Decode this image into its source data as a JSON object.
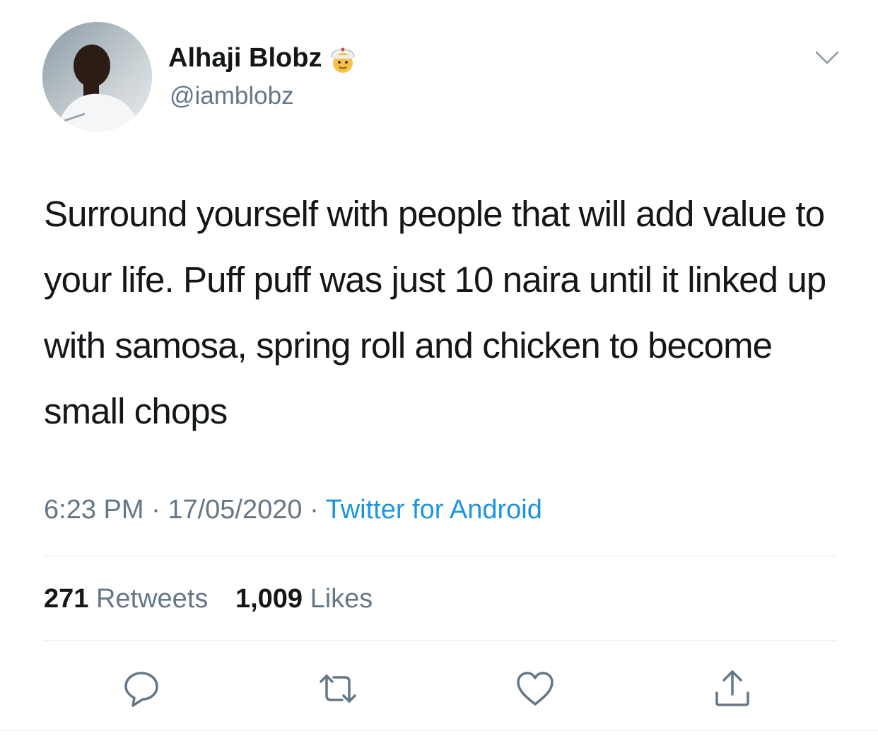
{
  "tweet": {
    "author": {
      "display_name": "Alhaji Blobz",
      "badge_emoji": "man-with-turban-emoji",
      "handle": "@iamblobz"
    },
    "menu_icon": "chevron-down-icon",
    "text": "Surround yourself with people that will add value to your life. Puff puff was just 10 naira until it linked up with samosa, spring roll and chicken to become small chops",
    "time": "6:23 PM",
    "separator": "·",
    "date": "17/05/2020",
    "source": "Twitter for Android",
    "stats": {
      "retweets_count": "271",
      "retweets_label": "Retweets",
      "likes_count": "1,009",
      "likes_label": "Likes"
    },
    "actions": [
      {
        "icon": "reply-icon"
      },
      {
        "icon": "retweet-icon"
      },
      {
        "icon": "like-icon"
      },
      {
        "icon": "share-icon"
      }
    ]
  },
  "colors": {
    "text_primary": "#14171a",
    "text_secondary": "#657786",
    "link": "#1b95e0",
    "divider": "#e1e8ed"
  }
}
